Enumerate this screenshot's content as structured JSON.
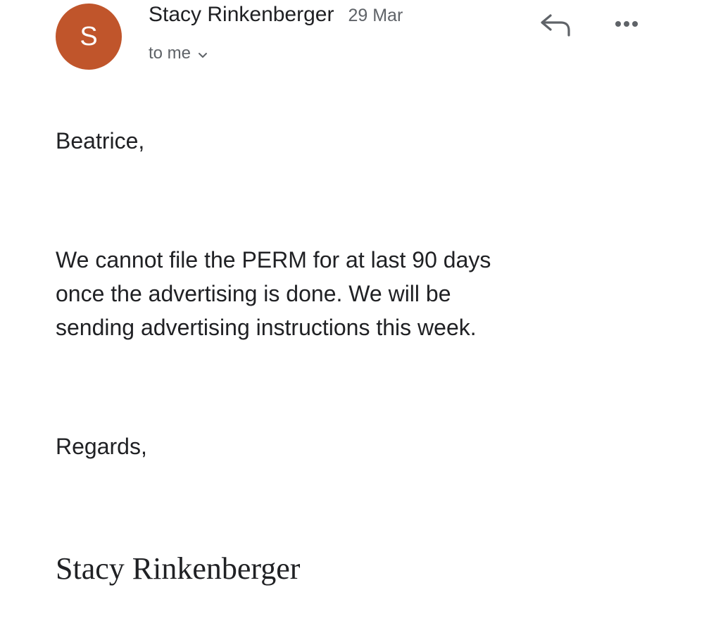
{
  "header": {
    "avatar_letter": "S",
    "sender_name": "Stacy Rinkenberger",
    "date": "29 Mar",
    "recipient": "to me",
    "reply_icon": "reply-arrow",
    "more_icon": "horizontal-ellipsis",
    "avatar_color": "#c0552b"
  },
  "message": {
    "greeting": "Beatrice,",
    "paragraph": "We cannot file the PERM for at last 90 days\nonce the advertising is done.  We will be\nsending advertising instructions this week.",
    "closing": "Regards,",
    "signature": "Stacy Rinkenberger"
  }
}
